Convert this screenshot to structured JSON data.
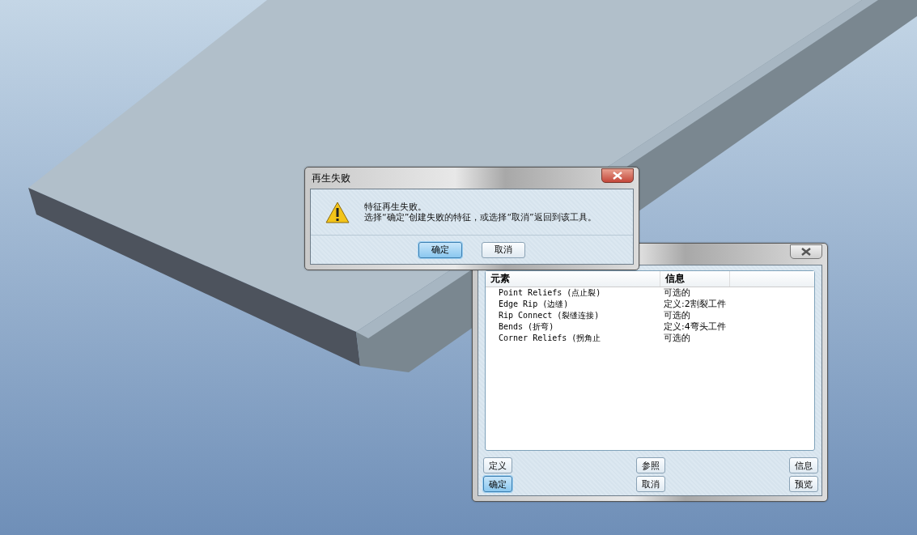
{
  "error_dialog": {
    "title": "再生失败",
    "message": [
      "特征再生失败。",
      "选择“确定”创建失败的特征，或选择“取消”返回到该工具。"
    ],
    "buttons": [
      {
        "label": "确定",
        "selected": true
      },
      {
        "label": "取消",
        "selected": false
      }
    ]
  },
  "feature_dialog": {
    "columns": [
      "元素",
      "信息"
    ],
    "rows": [
      {
        "element": "Point Reliefs (点止裂)",
        "info": "可选的"
      },
      {
        "element": "Edge Rip (边缝)",
        "info": "定义:2割裂工件"
      },
      {
        "element": "Rip Connect (裂缝连接)",
        "info": "可选的"
      },
      {
        "element": "Bends (折弯)",
        "info": "定义:4弯头工件"
      },
      {
        "element": "Corner Reliefs (拐角止",
        "info": "可选的"
      }
    ],
    "button_rows": [
      [
        {
          "label": "定义",
          "selected": false
        },
        {
          "label": "参照",
          "selected": false
        },
        {
          "label": "信息",
          "selected": false
        }
      ],
      [
        {
          "label": "确定",
          "selected": true
        },
        {
          "label": "取消",
          "selected": false
        },
        {
          "label": "预览",
          "selected": false
        }
      ]
    ]
  }
}
